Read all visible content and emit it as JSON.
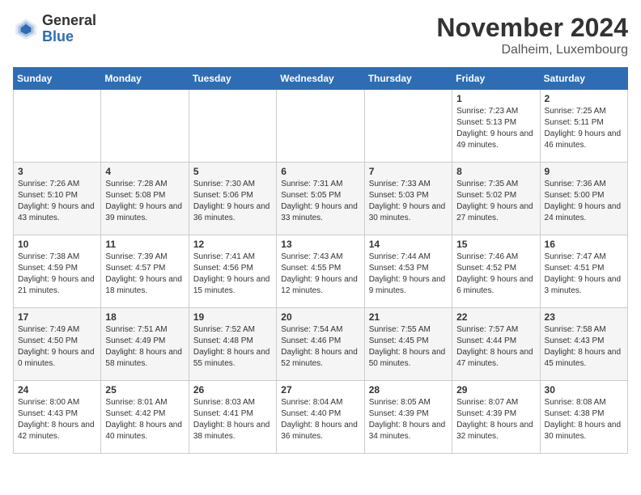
{
  "logo": {
    "general": "General",
    "blue": "Blue"
  },
  "title": "November 2024",
  "location": "Dalheim, Luxembourg",
  "days_header": [
    "Sunday",
    "Monday",
    "Tuesday",
    "Wednesday",
    "Thursday",
    "Friday",
    "Saturday"
  ],
  "weeks": [
    {
      "alt": false,
      "days": [
        {
          "num": "",
          "info": ""
        },
        {
          "num": "",
          "info": ""
        },
        {
          "num": "",
          "info": ""
        },
        {
          "num": "",
          "info": ""
        },
        {
          "num": "",
          "info": ""
        },
        {
          "num": "1",
          "info": "Sunrise: 7:23 AM\nSunset: 5:13 PM\nDaylight: 9 hours and 49 minutes."
        },
        {
          "num": "2",
          "info": "Sunrise: 7:25 AM\nSunset: 5:11 PM\nDaylight: 9 hours and 46 minutes."
        }
      ]
    },
    {
      "alt": true,
      "days": [
        {
          "num": "3",
          "info": "Sunrise: 7:26 AM\nSunset: 5:10 PM\nDaylight: 9 hours and 43 minutes."
        },
        {
          "num": "4",
          "info": "Sunrise: 7:28 AM\nSunset: 5:08 PM\nDaylight: 9 hours and 39 minutes."
        },
        {
          "num": "5",
          "info": "Sunrise: 7:30 AM\nSunset: 5:06 PM\nDaylight: 9 hours and 36 minutes."
        },
        {
          "num": "6",
          "info": "Sunrise: 7:31 AM\nSunset: 5:05 PM\nDaylight: 9 hours and 33 minutes."
        },
        {
          "num": "7",
          "info": "Sunrise: 7:33 AM\nSunset: 5:03 PM\nDaylight: 9 hours and 30 minutes."
        },
        {
          "num": "8",
          "info": "Sunrise: 7:35 AM\nSunset: 5:02 PM\nDaylight: 9 hours and 27 minutes."
        },
        {
          "num": "9",
          "info": "Sunrise: 7:36 AM\nSunset: 5:00 PM\nDaylight: 9 hours and 24 minutes."
        }
      ]
    },
    {
      "alt": false,
      "days": [
        {
          "num": "10",
          "info": "Sunrise: 7:38 AM\nSunset: 4:59 PM\nDaylight: 9 hours and 21 minutes."
        },
        {
          "num": "11",
          "info": "Sunrise: 7:39 AM\nSunset: 4:57 PM\nDaylight: 9 hours and 18 minutes."
        },
        {
          "num": "12",
          "info": "Sunrise: 7:41 AM\nSunset: 4:56 PM\nDaylight: 9 hours and 15 minutes."
        },
        {
          "num": "13",
          "info": "Sunrise: 7:43 AM\nSunset: 4:55 PM\nDaylight: 9 hours and 12 minutes."
        },
        {
          "num": "14",
          "info": "Sunrise: 7:44 AM\nSunset: 4:53 PM\nDaylight: 9 hours and 9 minutes."
        },
        {
          "num": "15",
          "info": "Sunrise: 7:46 AM\nSunset: 4:52 PM\nDaylight: 9 hours and 6 minutes."
        },
        {
          "num": "16",
          "info": "Sunrise: 7:47 AM\nSunset: 4:51 PM\nDaylight: 9 hours and 3 minutes."
        }
      ]
    },
    {
      "alt": true,
      "days": [
        {
          "num": "17",
          "info": "Sunrise: 7:49 AM\nSunset: 4:50 PM\nDaylight: 9 hours and 0 minutes."
        },
        {
          "num": "18",
          "info": "Sunrise: 7:51 AM\nSunset: 4:49 PM\nDaylight: 8 hours and 58 minutes."
        },
        {
          "num": "19",
          "info": "Sunrise: 7:52 AM\nSunset: 4:48 PM\nDaylight: 8 hours and 55 minutes."
        },
        {
          "num": "20",
          "info": "Sunrise: 7:54 AM\nSunset: 4:46 PM\nDaylight: 8 hours and 52 minutes."
        },
        {
          "num": "21",
          "info": "Sunrise: 7:55 AM\nSunset: 4:45 PM\nDaylight: 8 hours and 50 minutes."
        },
        {
          "num": "22",
          "info": "Sunrise: 7:57 AM\nSunset: 4:44 PM\nDaylight: 8 hours and 47 minutes."
        },
        {
          "num": "23",
          "info": "Sunrise: 7:58 AM\nSunset: 4:43 PM\nDaylight: 8 hours and 45 minutes."
        }
      ]
    },
    {
      "alt": false,
      "days": [
        {
          "num": "24",
          "info": "Sunrise: 8:00 AM\nSunset: 4:43 PM\nDaylight: 8 hours and 42 minutes."
        },
        {
          "num": "25",
          "info": "Sunrise: 8:01 AM\nSunset: 4:42 PM\nDaylight: 8 hours and 40 minutes."
        },
        {
          "num": "26",
          "info": "Sunrise: 8:03 AM\nSunset: 4:41 PM\nDaylight: 8 hours and 38 minutes."
        },
        {
          "num": "27",
          "info": "Sunrise: 8:04 AM\nSunset: 4:40 PM\nDaylight: 8 hours and 36 minutes."
        },
        {
          "num": "28",
          "info": "Sunrise: 8:05 AM\nSunset: 4:39 PM\nDaylight: 8 hours and 34 minutes."
        },
        {
          "num": "29",
          "info": "Sunrise: 8:07 AM\nSunset: 4:39 PM\nDaylight: 8 hours and 32 minutes."
        },
        {
          "num": "30",
          "info": "Sunrise: 8:08 AM\nSunset: 4:38 PM\nDaylight: 8 hours and 30 minutes."
        }
      ]
    }
  ]
}
